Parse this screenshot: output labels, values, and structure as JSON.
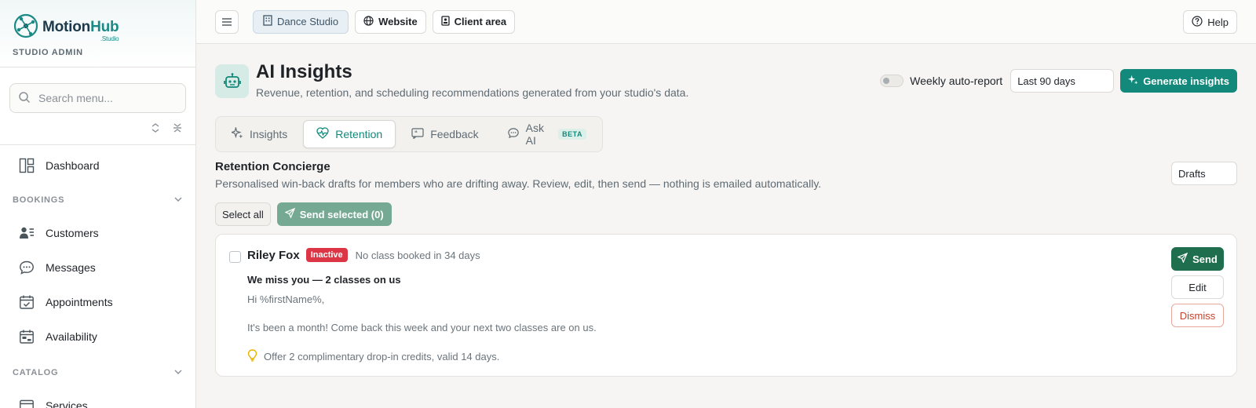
{
  "brand": {
    "name_a": "Motion",
    "name_b": "Hub",
    "sub": "Studio",
    "role": "STUDIO ADMIN"
  },
  "sidebar": {
    "search_placeholder": "Search menu...",
    "dashboard": "Dashboard",
    "sections": [
      {
        "title": "BOOKINGS",
        "items": [
          "Customers",
          "Messages",
          "Appointments",
          "Availability"
        ]
      },
      {
        "title": "CATALOG",
        "items": [
          "Services"
        ]
      }
    ]
  },
  "topbar": {
    "studio": "Dance Studio",
    "website": "Website",
    "client_area": "Client area",
    "help": "Help"
  },
  "header": {
    "title": "AI Insights",
    "subtitle": "Revenue, retention, and scheduling recommendations generated from your studio's data.",
    "auto_report_label": "Weekly auto-report",
    "range": "Last 90 days",
    "generate": "Generate insights"
  },
  "tabs": [
    {
      "label": "Insights"
    },
    {
      "label": "Retention"
    },
    {
      "label": "Feedback"
    },
    {
      "label": "Ask AI",
      "badge": "BETA"
    }
  ],
  "concierge": {
    "title": "Retention Concierge",
    "subtitle": "Personalised win-back drafts for members who are drifting away. Review, edit, then send — nothing is emailed automatically.",
    "filter": "Drafts",
    "select_all": "Select all",
    "send_selected": "Send selected (0)"
  },
  "draft": {
    "name": "Riley Fox",
    "status": "Inactive",
    "meta": "No class booked in 34 days",
    "subject": "We miss you — 2 classes on us",
    "greeting": "Hi %firstName%,",
    "body": "It's been a month! Come back this week and your next two classes are on us.",
    "offer": "Offer 2 complimentary drop-in credits, valid 14 days.",
    "send": "Send",
    "edit": "Edit",
    "dismiss": "Dismiss"
  },
  "colors": {
    "accent": "#12897a",
    "danger": "#dc3545",
    "send": "#1f6e4d"
  }
}
